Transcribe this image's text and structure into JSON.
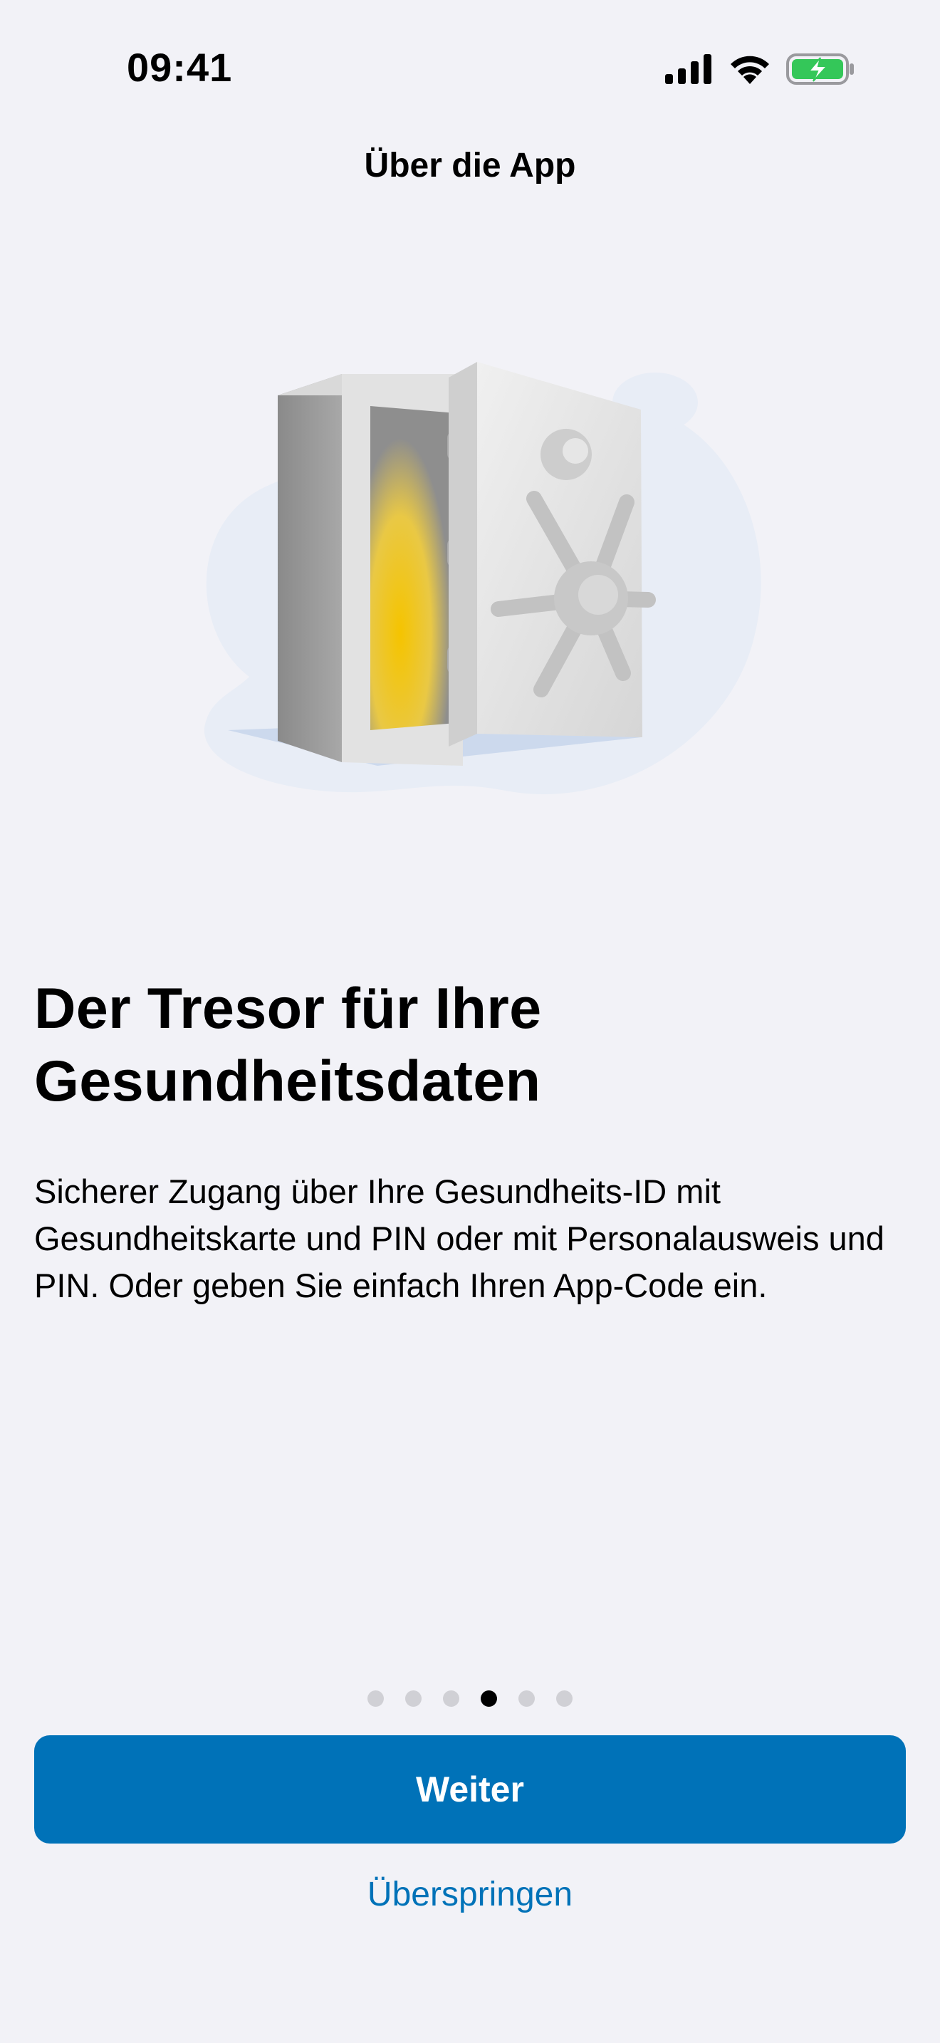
{
  "status_bar": {
    "time": "09:41",
    "icons": [
      "cellular-signal-icon",
      "wifi-icon",
      "battery-charging-icon"
    ],
    "battery_color": "#34C759"
  },
  "nav": {
    "title": "Über die App"
  },
  "illustration": {
    "icon": "safe-icon",
    "accent_color": "#F5C400"
  },
  "onboarding": {
    "headline": "Der Tresor für Ihre Gesundheitsdaten",
    "body": "Sicherer Zugang über Ihre Gesundheits-ID mit Gesundheitskarte und PIN oder mit Personalausweis und PIN. Oder geben Sie einfach Ihren App-Code ein.",
    "page_count": 6,
    "current_page": 4
  },
  "actions": {
    "primary_label": "Weiter",
    "secondary_label": "Überspringen"
  },
  "colors": {
    "background": "#F2F2F7",
    "accent": "#0072B8"
  }
}
